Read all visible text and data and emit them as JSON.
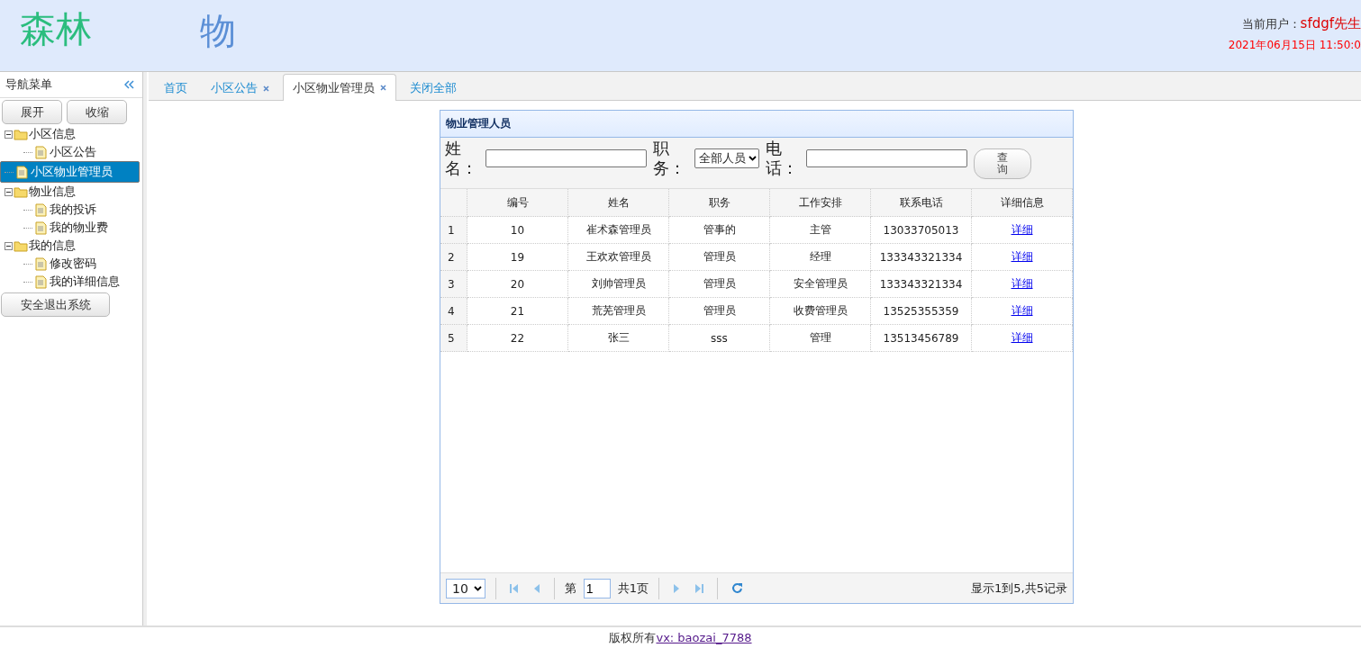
{
  "header": {
    "logo": "森林",
    "logo_2": "物",
    "user_label": "当前用户：",
    "user_name": "sfdgf先生",
    "datetime": "2021年06月15日 11:50:0"
  },
  "sidebar": {
    "title": "导航菜单",
    "buttons": [
      "展开",
      "收缩"
    ],
    "tree": [
      {
        "label": "小区信息",
        "expanded": true,
        "children": [
          {
            "label": "小区公告",
            "selected": false
          },
          {
            "label": "小区物业管理员",
            "selected": true
          }
        ]
      },
      {
        "label": "物业信息",
        "expanded": true,
        "children": [
          {
            "label": "我的投诉",
            "selected": false
          },
          {
            "label": "我的物业费",
            "selected": false
          }
        ]
      },
      {
        "label": "我的信息",
        "expanded": true,
        "children": [
          {
            "label": "修改密码",
            "selected": false
          },
          {
            "label": "我的详细信息",
            "selected": false
          }
        ]
      }
    ],
    "logout": "安全退出系统"
  },
  "tabs": [
    {
      "label": "首页",
      "selected": false,
      "closable": false
    },
    {
      "label": "小区公告",
      "selected": false,
      "closable": true
    },
    {
      "label": "小区物业管理员",
      "selected": true,
      "closable": true
    },
    {
      "label": "关闭全部",
      "selected": false,
      "closable": false
    }
  ],
  "panel": {
    "title": "物业管理人员",
    "search": {
      "name_label": "姓名：",
      "role_label": "职务：",
      "role_value": "全部人员",
      "phone_label": "电话：",
      "button": "查询"
    },
    "columns": [
      "编号",
      "姓名",
      "职务",
      "工作安排",
      "联系电话",
      "详细信息"
    ],
    "rows": [
      {
        "index": "1",
        "id": "10",
        "name": "崔术森管理员",
        "role": "管事的",
        "work": "主管",
        "phone": "13033705013",
        "link": "详细"
      },
      {
        "index": "2",
        "id": "19",
        "name": "王欢欢管理员",
        "role": "管理员",
        "work": "经理",
        "phone": "133343321334",
        "link": "详细"
      },
      {
        "index": "3",
        "id": "20",
        "name": "刘帅管理员",
        "role": "管理员",
        "work": "安全管理员",
        "phone": "133343321334",
        "link": "详细"
      },
      {
        "index": "4",
        "id": "21",
        "name": "荒芜管理员",
        "role": "管理员",
        "work": "收费管理员",
        "phone": "13525355359",
        "link": "详细"
      },
      {
        "index": "5",
        "id": "22",
        "name": "张三",
        "role": "sss",
        "work": "管理",
        "phone": "13513456789",
        "link": "详细"
      }
    ],
    "pager": {
      "page_size": "10",
      "page_prefix": "第",
      "page": "1",
      "page_total": "共1页",
      "summary": "显示1到5,共5记录"
    }
  },
  "footer": {
    "text": "版权所有",
    "link": "vx: baozai_7788"
  }
}
